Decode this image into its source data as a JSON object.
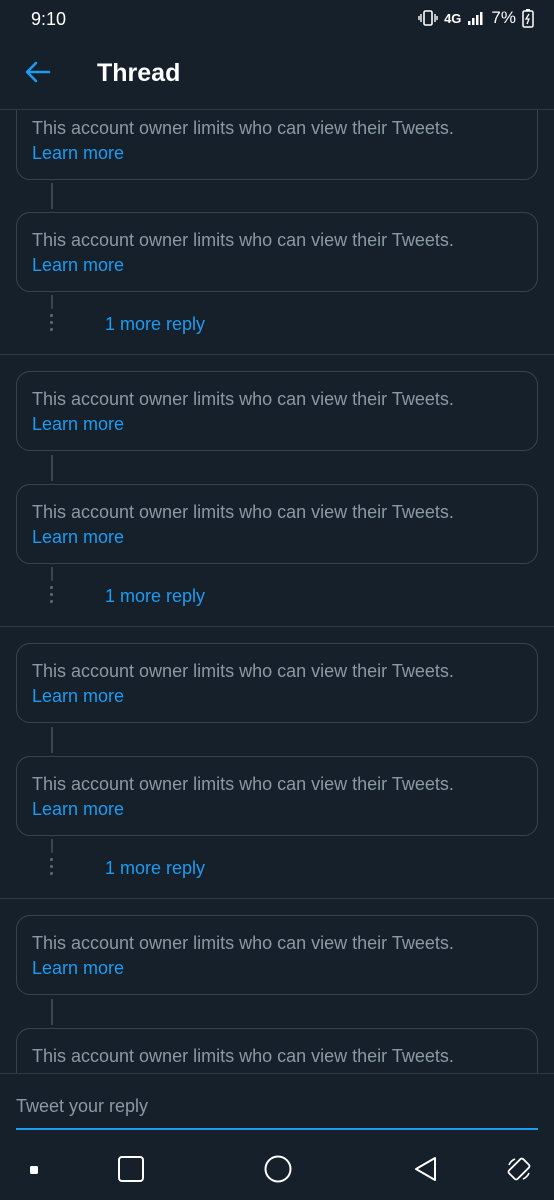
{
  "status": {
    "time": "9:10",
    "network": "4G",
    "battery": "7%"
  },
  "header": {
    "title": "Thread"
  },
  "restricted": {
    "message": "This account owner limits who can view their Tweets.",
    "link": "Learn more"
  },
  "more_reply_label": "1 more reply",
  "reply": {
    "placeholder": "Tweet your reply"
  },
  "colors": {
    "background": "#15202b",
    "accent": "#1d9bf0",
    "muted_text": "#8b98a5",
    "border": "#38444d"
  }
}
